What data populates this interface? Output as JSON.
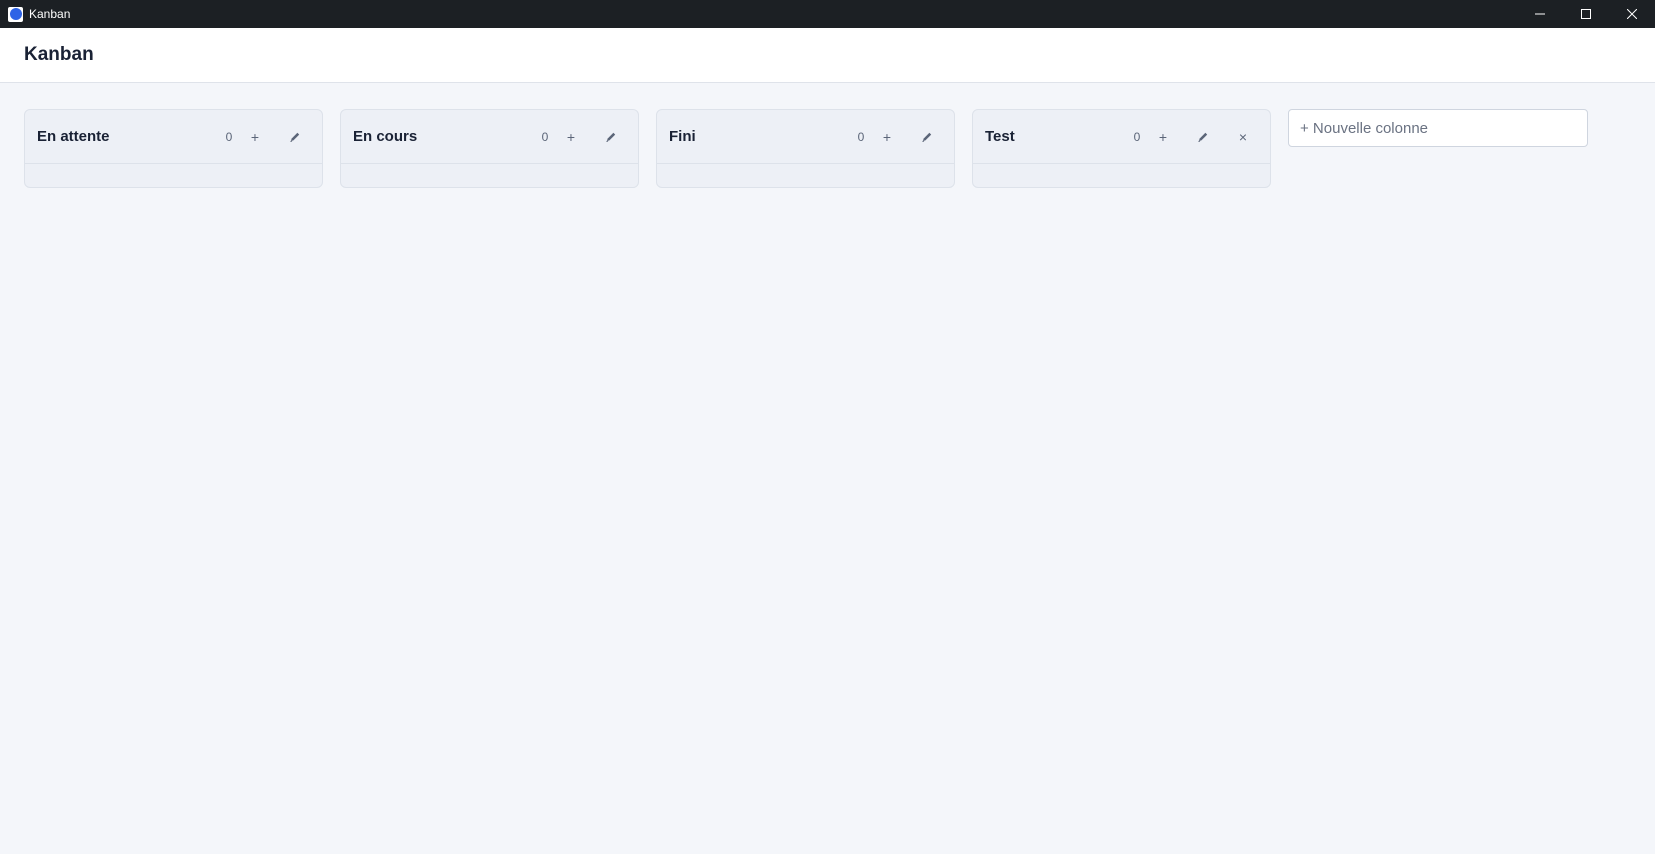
{
  "window": {
    "title": "Kanban",
    "icon": "app-circle-icon",
    "controls": [
      "minimize-icon",
      "maximize-icon",
      "close-icon"
    ]
  },
  "header": {
    "title": "Kanban"
  },
  "columns": [
    {
      "title": "En attente",
      "count": "0",
      "add_label": "+",
      "deletable": false
    },
    {
      "title": "En cours",
      "count": "0",
      "add_label": "+",
      "deletable": false
    },
    {
      "title": "Fini",
      "count": "0",
      "add_label": "+",
      "deletable": false
    },
    {
      "title": "Test",
      "count": "0",
      "add_label": "+",
      "delete_label": "×",
      "deletable": true
    }
  ],
  "new_column": {
    "placeholder": "+ Nouvelle colonne",
    "value": ""
  },
  "colors": {
    "titlebar_bg": "#1c2024",
    "accent": "#2e63e6",
    "page_bg": "#f4f6fa",
    "column_bg": "#edf0f6",
    "text_primary": "#1a2235",
    "text_muted": "#5b6578"
  }
}
